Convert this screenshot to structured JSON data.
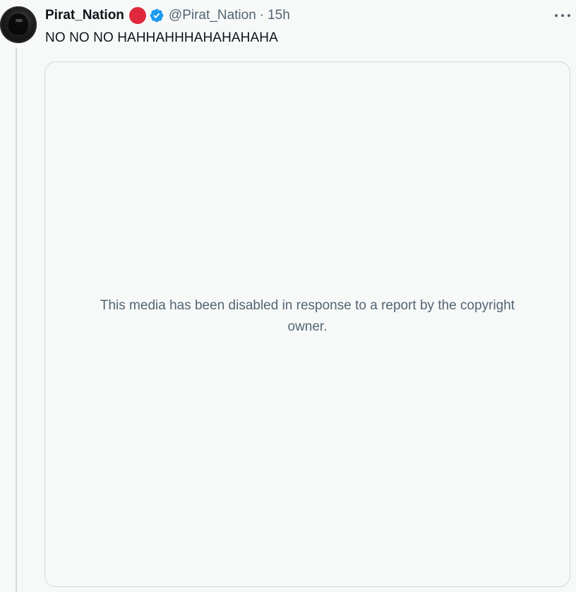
{
  "tweet": {
    "display_name": "Pirat_Nation",
    "handle": "@Pirat_Nation",
    "separator": "·",
    "time": "15h",
    "text": "NO NO NO HAHHAHHHAHAHAHAHA",
    "media_notice": "This media has been disabled in response to a report by the copyright owner."
  },
  "icons": {
    "badge": "red-circle-badge-icon",
    "verified": "verified-badge-icon",
    "more": "more-options-icon"
  },
  "colors": {
    "background": "#f7f9f9",
    "primary_text": "#0f1419",
    "secondary_text": "#536471",
    "verified_blue": "#1d9bf0",
    "red_badge": "#e0283c",
    "border": "#cfd9de"
  }
}
